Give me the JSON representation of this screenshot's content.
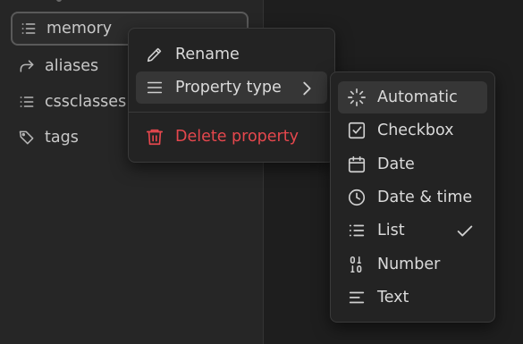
{
  "properties": [
    {
      "label": "memory",
      "icon": "list-icon"
    },
    {
      "label": "aliases",
      "icon": "forward-arrow-icon"
    },
    {
      "label": "cssclasses",
      "icon": "list-icon"
    },
    {
      "label": "tags",
      "icon": "tag-icon"
    }
  ],
  "context_menu": {
    "rename": "Rename",
    "property_type": "Property type",
    "delete": "Delete property"
  },
  "type_menu": {
    "items": [
      {
        "label": "Automatic",
        "icon": "sparkle-icon"
      },
      {
        "label": "Checkbox",
        "icon": "checkbox-icon"
      },
      {
        "label": "Date",
        "icon": "calendar-icon"
      },
      {
        "label": "Date & time",
        "icon": "clock-icon"
      },
      {
        "label": "List",
        "icon": "list-icon",
        "checked": true
      },
      {
        "label": "Number",
        "icon": "binary-icon"
      },
      {
        "label": "Text",
        "icon": "text-lines-icon"
      }
    ]
  },
  "colors": {
    "danger": "#e5474d",
    "background": "#262626",
    "menu": "#232323"
  }
}
